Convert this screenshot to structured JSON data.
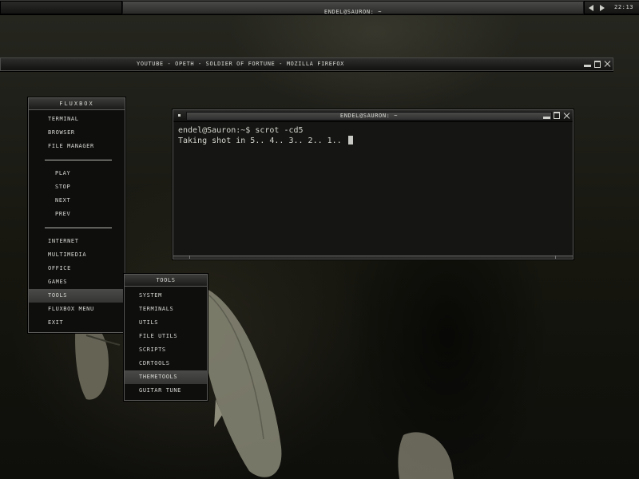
{
  "panel": {
    "title": "endel@Sauron: ~",
    "clock": "22:13",
    "prev_icon": "prev-workspace-icon",
    "next_icon": "next-workspace-icon"
  },
  "firefox_window": {
    "title": "YouTube - Opeth - Soldier of Fortune - Mozilla Firefox"
  },
  "terminal": {
    "title": "endel@Sauron: ~",
    "lines": [
      "endel@Sauron:~$ scrot -cd5",
      "Taking shot in 5.. 4.. 3.. 2.. 1.. "
    ]
  },
  "root_menu": {
    "title": "Fluxbox",
    "items": [
      {
        "label": "Terminal"
      },
      {
        "label": "Browser"
      },
      {
        "label": "File Manager"
      },
      {
        "label": "Play"
      },
      {
        "label": "Stop"
      },
      {
        "label": "Next"
      },
      {
        "label": "Prev"
      },
      {
        "label": "Internet"
      },
      {
        "label": "Multimedia"
      },
      {
        "label": "Office"
      },
      {
        "label": "Games"
      },
      {
        "label": "Tools"
      },
      {
        "label": "Fluxbox menu"
      },
      {
        "label": "Exit"
      }
    ]
  },
  "tools_menu": {
    "title": "Tools",
    "items": [
      {
        "label": "System"
      },
      {
        "label": "Terminals"
      },
      {
        "label": "Utils"
      },
      {
        "label": "File Utils"
      },
      {
        "label": "Scripts"
      },
      {
        "label": "CDRTools"
      },
      {
        "label": "ThemeTools"
      },
      {
        "label": "Guitar Tune"
      }
    ]
  },
  "colors": {
    "menu_highlight": "#4a4a48",
    "text": "#d8d8d4"
  }
}
